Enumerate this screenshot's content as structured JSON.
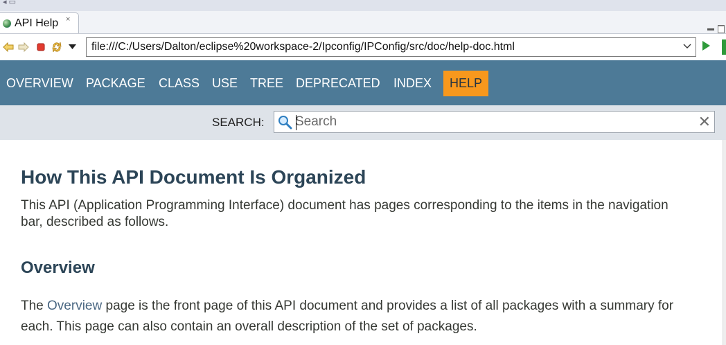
{
  "window": {
    "tab_title": "API Help",
    "tab_close_glyph": "×"
  },
  "toolbar": {
    "url": "file:///C:/Users/Dalton/eclipse%20workspace-2/Ipconfig/IPConfig/src/doc/help-doc.html",
    "icons": [
      "back-icon",
      "forward-icon",
      "stop-icon",
      "refresh-icon",
      "menu-dropdown-icon",
      "url-dropdown-icon",
      "go-icon"
    ]
  },
  "nav": {
    "items": [
      "OVERVIEW",
      "PACKAGE",
      "CLASS",
      "USE",
      "TREE",
      "DEPRECATED",
      "INDEX",
      "HELP"
    ],
    "active": "HELP",
    "colors": {
      "bar": "#4d7a97",
      "active_bg": "#f8981d",
      "subnav": "#dee3e9"
    }
  },
  "search": {
    "label": "SEARCH:",
    "placeholder": "Search",
    "value": ""
  },
  "content": {
    "title": "How This API Document Is Organized",
    "intro": "This API (Application Programming Interface) document has pages corresponding to the items in the navigation bar, described as follows.",
    "section_title": "Overview",
    "section_text_before": "The ",
    "section_link": "Overview",
    "section_text_after": " page is the front page of this API document and provides a list of all packages with a summary for each. This page can also contain an overall description of the set of packages."
  }
}
